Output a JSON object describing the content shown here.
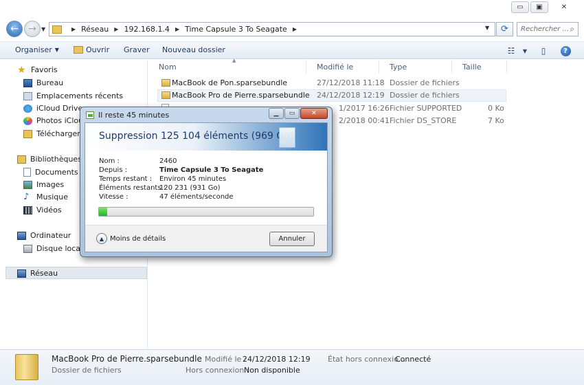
{
  "window": {
    "minimize": "▭",
    "maximize": "▣",
    "close": "✕"
  },
  "address": {
    "crumbs": [
      "Réseau",
      "192.168.1.4",
      "Time Capsule 3 To Seagate"
    ],
    "search_placeholder": "Rechercher ..."
  },
  "toolbar": {
    "organiser": "Organiser",
    "ouvrir": "Ouvrir",
    "graver": "Graver",
    "nouveau_dossier": "Nouveau dossier"
  },
  "nav": {
    "favoris": "Favoris",
    "bureau": "Bureau",
    "emplacements": "Emplacements récents",
    "icloud": "iCloud Drive",
    "photos": "Photos iCloud",
    "telechargements": "Téléchargeme",
    "bibliotheques": "Bibliothèques",
    "documents": "Documents",
    "images": "Images",
    "musique": "Musique",
    "videos": "Vidéos",
    "ordinateur": "Ordinateur",
    "disque": "Disque local (C",
    "reseau": "Réseau"
  },
  "columns": {
    "nom": "Nom",
    "modifie": "Modifié le",
    "type": "Type",
    "taille": "Taille"
  },
  "files": [
    {
      "name": "MacBook de Pon.sparsebundle",
      "date": "27/12/2018 11:18",
      "type": "Dossier de fichiers",
      "size": ""
    },
    {
      "name": "MacBook Pro de Pierre.sparsebundle",
      "date": "24/12/2018 12:19",
      "type": "Dossier de fichiers",
      "size": ""
    },
    {
      "name": "",
      "date": "1/2017 16:26",
      "type": "Fichier SUPPORTED",
      "size": "0 Ko"
    },
    {
      "name": "",
      "date": "2/2018 00:41",
      "type": "Fichier DS_STORE",
      "size": "7 Ko"
    }
  ],
  "dialog": {
    "title": "Il reste 45 minutes",
    "heading": "Suppression 125 104 éléments (969 Go)",
    "labels": {
      "nom": "Nom :",
      "depuis": "Depuis :",
      "temps": "Temps restant :",
      "elements": "Éléments restants :",
      "vitesse": "Vitesse :"
    },
    "values": {
      "nom": "2460",
      "depuis": "Time Capsule 3 To Seagate",
      "temps": "Environ 45 minutes",
      "elements": "120 231 (931 Go)",
      "vitesse": "47 éléments/seconde"
    },
    "progress": 0.04,
    "less_details": "Moins de détails",
    "cancel": "Annuler"
  },
  "details": {
    "name": "MacBook Pro de Pierre.sparsebundle",
    "type": "Dossier de fichiers",
    "modified_label": "Modifié le :",
    "modified_value": "24/12/2018 12:19",
    "offline_state_label": "État hors connexio...",
    "offline_state_value": "Connecté",
    "offline_label": "Hors connexion :",
    "offline_value": "Non disponible"
  }
}
